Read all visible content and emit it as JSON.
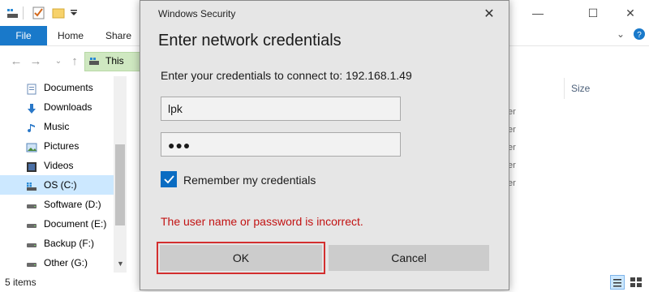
{
  "explorer": {
    "ribbon_tabs": {
      "file": "File",
      "home": "Home",
      "share": "Share"
    },
    "address": {
      "text": "This"
    },
    "nav_items": [
      {
        "label": "Documents",
        "icon": "documents-icon"
      },
      {
        "label": "Downloads",
        "icon": "downloads-icon"
      },
      {
        "label": "Music",
        "icon": "music-icon"
      },
      {
        "label": "Pictures",
        "icon": "pictures-icon"
      },
      {
        "label": "Videos",
        "icon": "videos-icon"
      },
      {
        "label": "OS (C:)",
        "icon": "drive-os-icon",
        "selected": true
      },
      {
        "label": "Software (D:)",
        "icon": "drive-icon"
      },
      {
        "label": "Document (E:)",
        "icon": "drive-icon"
      },
      {
        "label": "Backup (F:)",
        "icon": "drive-icon"
      },
      {
        "label": "Other (G:)",
        "icon": "drive-icon"
      }
    ],
    "column_header": "Size",
    "type_fragments": [
      "er",
      "er",
      "er",
      "er",
      "er"
    ],
    "status_text": "5 items"
  },
  "dialog": {
    "window_title": "Windows Security",
    "heading": "Enter network credentials",
    "prompt": "Enter your credentials to connect to: 192.168.1.49",
    "username_value": "lpk",
    "password_mask": "●●●",
    "remember_label": "Remember my credentials",
    "remember_checked": true,
    "error_text": "The user name or password is incorrect.",
    "ok_label": "OK",
    "cancel_label": "Cancel"
  },
  "colors": {
    "accent": "#0a6cc2",
    "error": "#c21212",
    "file_tab": "#1979ca",
    "highlight_outline": "#d32f2f"
  }
}
